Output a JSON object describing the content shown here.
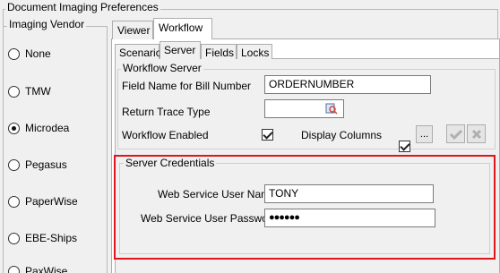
{
  "window": {
    "title": "Document Imaging Preferences"
  },
  "vendor": {
    "title": "Imaging Vendor",
    "options": [
      {
        "label": "None",
        "selected": false
      },
      {
        "label": "TMW",
        "selected": false
      },
      {
        "label": "Microdea",
        "selected": true
      },
      {
        "label": "Pegasus",
        "selected": false
      },
      {
        "label": "PaperWise",
        "selected": false
      },
      {
        "label": "EBE-Ships",
        "selected": false
      },
      {
        "label": "PaxWise",
        "selected": false
      }
    ]
  },
  "tabs": [
    {
      "label": "Viewer",
      "active": false
    },
    {
      "label": "Workflow",
      "active": true
    }
  ],
  "subtabs": [
    {
      "label": "Scenario",
      "active": false
    },
    {
      "label": "Server",
      "active": true
    },
    {
      "label": "Fields",
      "active": false
    },
    {
      "label": "Locks",
      "active": false
    }
  ],
  "workflow_server": {
    "title": "Workflow Server",
    "bill_number_label": "Field Name for Bill Number",
    "bill_number_value": "ORDERNUMBER",
    "return_trace_label": "Return Trace Type",
    "return_trace_value": "",
    "enabled_label": "Workflow Enabled",
    "enabled": true,
    "display_columns_label": "Display Columns",
    "display_columns": true,
    "ellipsis_label": "...",
    "lookup_icon": "lookup-icon",
    "accept_icon": "check-icon",
    "reject_icon": "x-icon"
  },
  "credentials": {
    "title": "Server Credentials",
    "user_label": "Web Service User Name",
    "user_value": "TONY",
    "password_label": "Web Service User Password",
    "password_value": "●●●●●●",
    "highlight_color": "#e0141b"
  }
}
